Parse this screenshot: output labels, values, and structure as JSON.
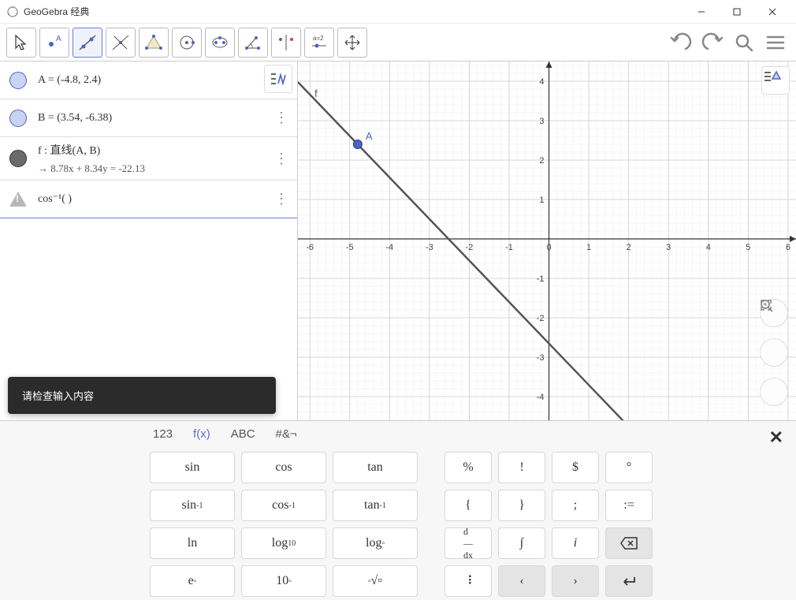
{
  "titlebar": {
    "title": "GeoGebra 经典"
  },
  "algebra": {
    "rows": [
      {
        "label": "A = (-4.8, 2.4)",
        "bullet": "blue",
        "more": false
      },
      {
        "label": "B = (3.54, -6.38)",
        "bullet": "blue",
        "more": true
      },
      {
        "label": "f : 直线(A, B)",
        "sub": "→  8.78x + 8.34y = -22.13",
        "bullet": "black",
        "more": true
      },
      {
        "label": "cos⁻¹(  )",
        "bullet": "warn",
        "more": true,
        "active": true
      }
    ],
    "tooltip": "请检查输入内容"
  },
  "graph": {
    "point_label": "A",
    "func_label": "f",
    "xticks": [
      "-6",
      "-5",
      "-4",
      "-3",
      "-2",
      "-1",
      "0",
      "1",
      "2",
      "3",
      "4",
      "5",
      "6"
    ],
    "yticks_pos": [
      "1",
      "2",
      "3",
      "4"
    ],
    "yticks_neg": [
      "-1",
      "-2",
      "-3",
      "-4"
    ]
  },
  "keyboard": {
    "tabs": [
      "123",
      "f(x)",
      "ABC",
      "#&¬"
    ],
    "active_tab": 1,
    "rows": [
      [
        {
          "t": "sin",
          "cls": "w"
        },
        {
          "t": "cos",
          "cls": "w"
        },
        {
          "t": "tan",
          "cls": "w"
        },
        null,
        {
          "t": "%",
          "cls": "ws"
        },
        {
          "t": "!",
          "cls": "ws"
        },
        {
          "t": "$",
          "cls": "ws"
        },
        {
          "t": "°",
          "cls": "ws"
        }
      ],
      [
        {
          "html": "sin<sup>-1</sup>",
          "name": "asin",
          "cls": "w"
        },
        {
          "html": "cos<sup>-1</sup>",
          "name": "acos",
          "cls": "w"
        },
        {
          "html": "tan<sup>-1</sup>",
          "name": "atan",
          "cls": "w"
        },
        null,
        {
          "t": "{",
          "cls": "ws"
        },
        {
          "t": "}",
          "cls": "ws"
        },
        {
          "t": ";",
          "cls": "ws"
        },
        {
          "t": ":=",
          "cls": "ws"
        }
      ],
      [
        {
          "t": "ln",
          "cls": "w"
        },
        {
          "html": "log<sub>10</sub>",
          "name": "log10",
          "cls": "w"
        },
        {
          "html": "log<sub>▫</sub>",
          "name": "logb",
          "cls": "w"
        },
        null,
        {
          "html": "<span style='font-size:12px'>d<br>―<br>dx</span>",
          "name": "ddx",
          "cls": "ws"
        },
        {
          "t": "∫",
          "cls": "ws"
        },
        {
          "html": "<i>i</i>",
          "name": "imag",
          "cls": "ws"
        },
        {
          "icon": "backspace",
          "cls": "ws gray"
        }
      ],
      [
        {
          "html": "e<sup>▫</sup>",
          "name": "exp",
          "cls": "w"
        },
        {
          "html": "10<sup>▫</sup>",
          "name": "pow10",
          "cls": "w"
        },
        {
          "html": "<sup>▫</sup>√▫",
          "name": "nroot",
          "cls": "w"
        },
        null,
        {
          "t": "⠸",
          "name": "more",
          "cls": "ws"
        },
        {
          "t": "‹",
          "name": "left",
          "cls": "ws gray"
        },
        {
          "t": "›",
          "name": "right",
          "cls": "ws gray"
        },
        {
          "icon": "enter",
          "cls": "ws gray"
        }
      ]
    ]
  },
  "chart_data": {
    "type": "line",
    "title": "",
    "points": {
      "A": [
        -4.8,
        2.4
      ],
      "B": [
        3.54,
        -6.38
      ]
    },
    "line_f": {
      "a": 8.78,
      "b": 8.34,
      "c": -22.13,
      "form": "8.78x + 8.34y = -22.13"
    },
    "x_range": [
      -6.3,
      6.2
    ],
    "y_range": [
      -4.6,
      4.5
    ],
    "grid": true
  }
}
